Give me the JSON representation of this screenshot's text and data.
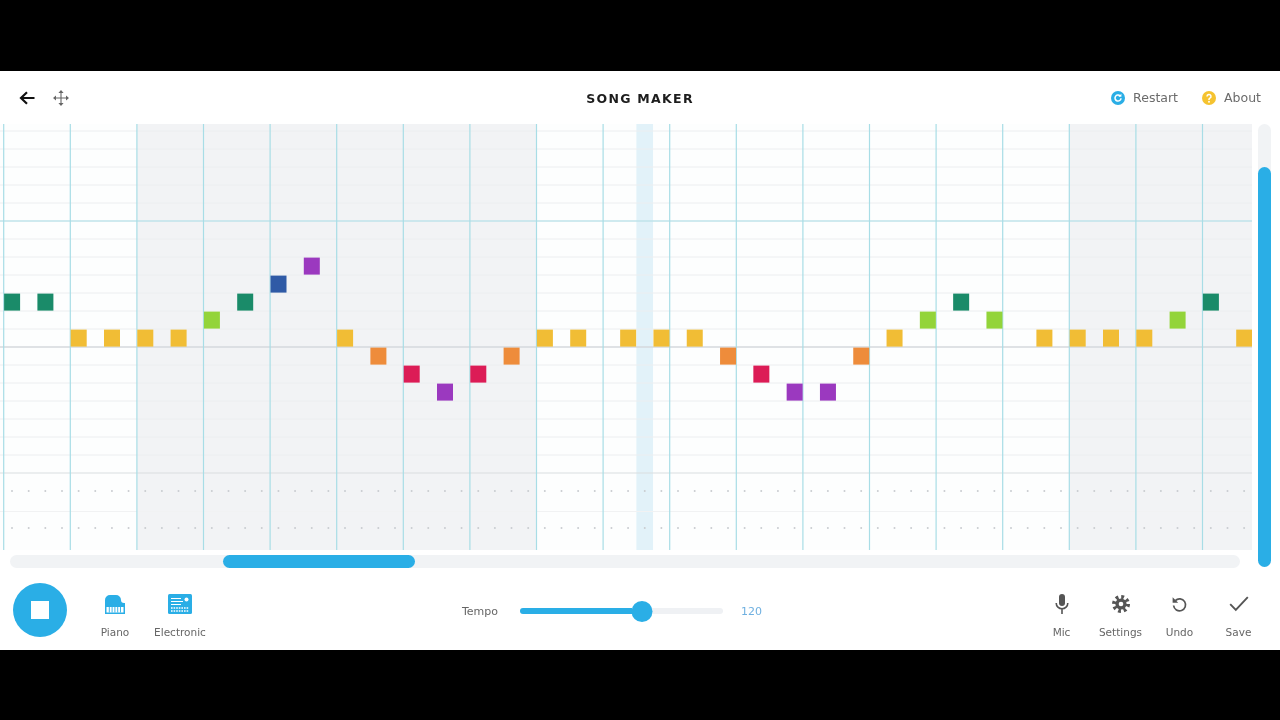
{
  "header": {
    "title": "SONG MAKER",
    "actions": [
      {
        "kind": "restart",
        "label": "Restart"
      },
      {
        "kind": "about",
        "label": "About"
      }
    ]
  },
  "melody": {
    "notes": [
      {
        "color": "#1a8b69"
      },
      {
        "color": "#1a8b69"
      },
      {
        "color": "#f1bd35"
      },
      {
        "color": "#f1bd35"
      },
      {
        "color": "#f1bd35"
      },
      {
        "color": "#f1bd35"
      },
      {
        "color": "#93d43a"
      },
      {
        "color": "#1a8b69"
      },
      {
        "color": "#2f5aa6"
      },
      {
        "color": "#9b39bf"
      },
      {
        "color": "#f1bd35"
      },
      {
        "color": "#ee8c3b"
      },
      {
        "color": "#dc1c56"
      },
      {
        "color": "#9b39bf"
      },
      {
        "color": "#dc1c56"
      },
      {
        "color": "#ee8c3b"
      },
      {
        "color": "#f1bd35"
      },
      {
        "color": "#f1bd35"
      },
      {
        "color": "#f1bd35"
      },
      {
        "color": "#f1bd35"
      },
      {
        "color": "#f1bd35"
      },
      {
        "color": "#ee8c3b"
      },
      {
        "color": "#dc1c56"
      },
      {
        "color": "#9b39bf"
      },
      {
        "color": "#9b39bf"
      },
      {
        "color": "#ee8c3b"
      },
      {
        "color": "#f1bd35"
      },
      {
        "color": "#93d43a"
      },
      {
        "color": "#1a8b69"
      },
      {
        "color": "#93d43a"
      },
      {
        "color": "#f1bd35"
      },
      {
        "color": "#f1bd35"
      },
      {
        "color": "#f1bd35"
      },
      {
        "color": "#f1bd35"
      },
      {
        "color": "#93d43a"
      },
      {
        "color": "#1a8b69"
      },
      {
        "color": "#f1bd35"
      }
    ]
  },
  "transport": {
    "playing": true
  },
  "instruments": [
    {
      "kind": "piano",
      "label": "Piano"
    },
    {
      "kind": "electronic",
      "label": "Electronic"
    }
  ],
  "tempo": {
    "label": "Tempo",
    "level": 0.6,
    "reading": "120"
  },
  "tools": [
    {
      "kind": "mic",
      "label": "Mic"
    },
    {
      "kind": "settings",
      "label": "Settings"
    },
    {
      "kind": "undo",
      "label": "Undo"
    },
    {
      "kind": "save",
      "label": "Save"
    }
  ]
}
